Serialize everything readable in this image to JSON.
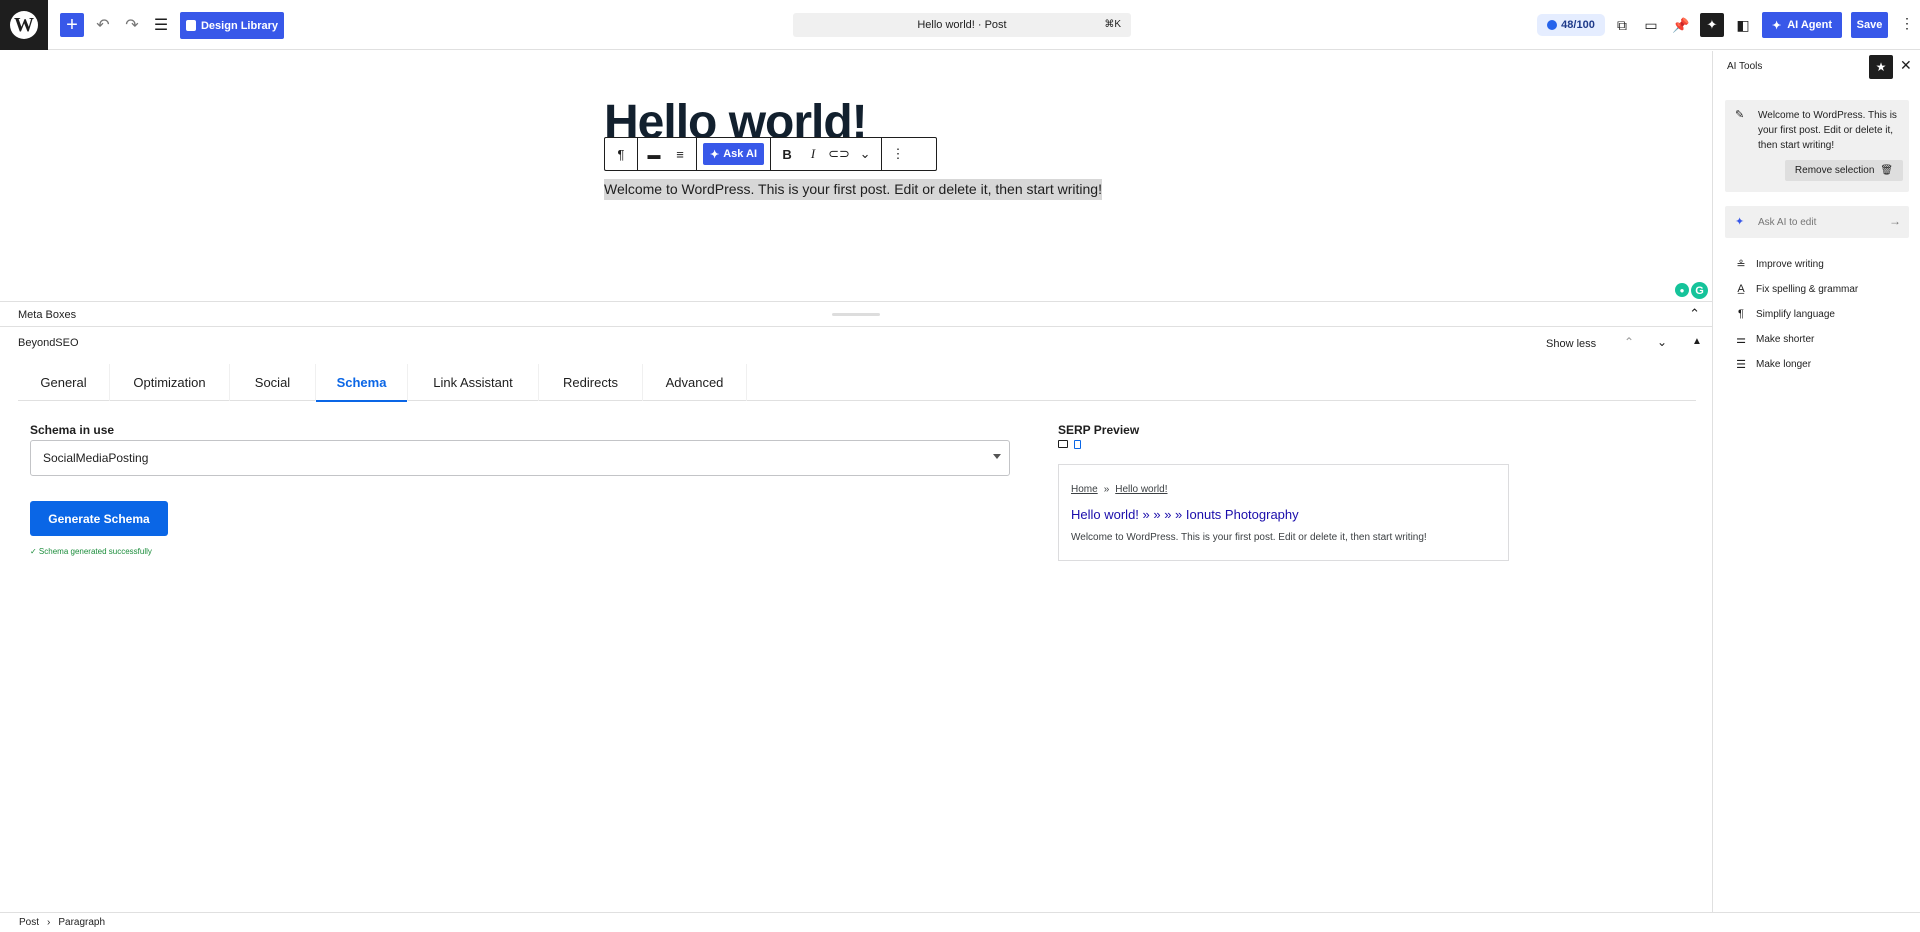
{
  "topbar": {
    "design_library": "Design Library",
    "command": "Hello world! · Post",
    "shortcut": "⌘K",
    "score": "48/100",
    "ai_agent": "AI Agent",
    "save": "Save"
  },
  "editor": {
    "title": "Hello world!",
    "paragraph": "Welcome to WordPress. This is your first post. Edit or delete it, then start writing!",
    "ask_ai": "Ask AI"
  },
  "meta": {
    "label": "Meta Boxes",
    "plugin": "BeyondSEO",
    "show_less": "Show less",
    "tabs": [
      "General",
      "Optimization",
      "Social",
      "Schema",
      "Link Assistant",
      "Redirects",
      "Advanced"
    ],
    "active_tab": "Schema"
  },
  "schema": {
    "label": "Schema in use",
    "value": "SocialMediaPosting",
    "generate": "Generate Schema",
    "success": "✓ Schema generated successfully"
  },
  "serp": {
    "label": "SERP Preview",
    "crumb_home": "Home",
    "crumb_sep": "»",
    "crumb_page": "Hello world!",
    "title": "Hello world! » » » » Ionuts Photography",
    "desc": "Welcome to WordPress. This is your first post. Edit or delete it, then start writing!"
  },
  "footer": {
    "crumb1": "Post",
    "sep": "›",
    "crumb2": "Paragraph"
  },
  "sidebar": {
    "title": "AI Tools",
    "selection": "Welcome to WordPress. This is your first post. Edit or delete it, then start writing!",
    "remove": "Remove selection",
    "ask_placeholder": "Ask AI to edit",
    "actions": [
      "Improve writing",
      "Fix spelling & grammar",
      "Simplify language",
      "Make shorter",
      "Make longer"
    ]
  },
  "colors": {
    "wp_blue": "#3858e9",
    "seo_blue": "#0a66e6",
    "serp_link": "#1a0dab",
    "success": "#1a8c3a"
  }
}
